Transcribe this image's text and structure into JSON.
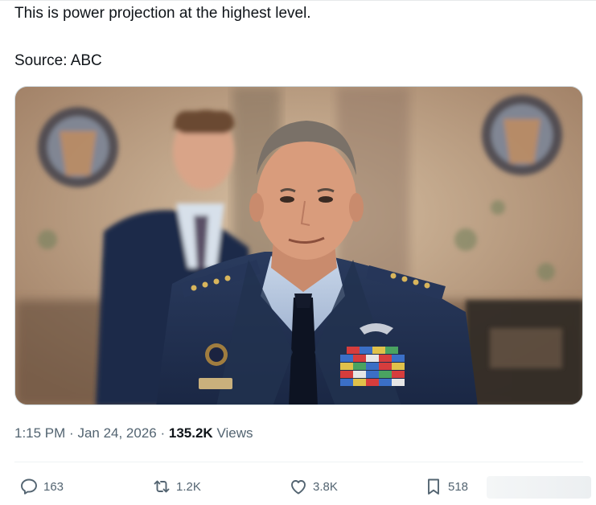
{
  "tweet": {
    "text_line1": "This is power projection at the highest level.",
    "text_line2": "Source: ABC",
    "photo_alt": "Photo"
  },
  "meta": {
    "time": "1:15 PM",
    "date": "Jan 24, 2026",
    "views_count": "135.2K",
    "views_label": "Views"
  },
  "actions": {
    "replies": "163",
    "reposts": "1.2K",
    "likes": "3.8K",
    "bookmarks": "518"
  },
  "icons": {
    "reply": "reply-icon",
    "repost": "repost-icon",
    "like": "heart-icon",
    "bookmark": "bookmark-icon",
    "share": "share-icon"
  },
  "colors": {
    "text_primary": "#0f1419",
    "text_secondary": "#536471",
    "border": "#cfd9de"
  }
}
